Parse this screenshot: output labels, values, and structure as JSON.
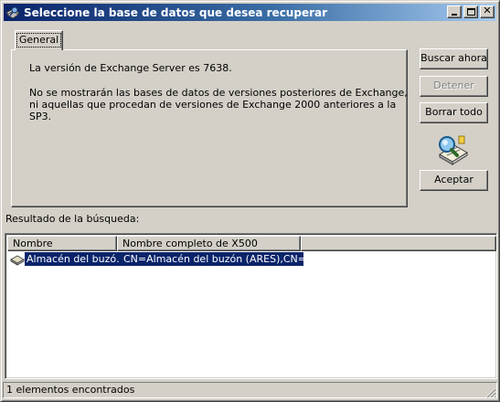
{
  "window": {
    "title": "Seleccione la base de datos que desea recuperar"
  },
  "tabs": [
    {
      "label": "General",
      "selected": true
    }
  ],
  "panel": {
    "version_text": "La versión de Exchange Server es 7638.",
    "note_line1": "No se mostrarán las bases de datos de versiones posteriores de Exchange,",
    "note_line2": "ni aquellas que procedan de versiones de Exchange 2000 anteriores a la",
    "note_line3": "SP3."
  },
  "buttons": {
    "search_now": "Buscar ahora",
    "stop": "Detener",
    "clear_all": "Borrar todo",
    "accept": "Aceptar"
  },
  "results": {
    "label": "Resultado de la búsqueda:",
    "columns": [
      "Nombre",
      "Nombre completo de X500"
    ],
    "rows": [
      {
        "name": "Almacén del buzó…",
        "x500": "CN=Almacén del buzón (ARES),CN=…",
        "selected": true
      }
    ]
  },
  "status": {
    "text": "1 elementos encontrados"
  },
  "icons": {
    "title": "search-database-icon",
    "animation": "magnifier-search-icon",
    "row": "mailbox-store-icon"
  },
  "colors": {
    "titlebar_start": "#0a246a",
    "titlebar_end": "#a6caf0",
    "face": "#d4d0c8",
    "selection": "#0a246a"
  }
}
